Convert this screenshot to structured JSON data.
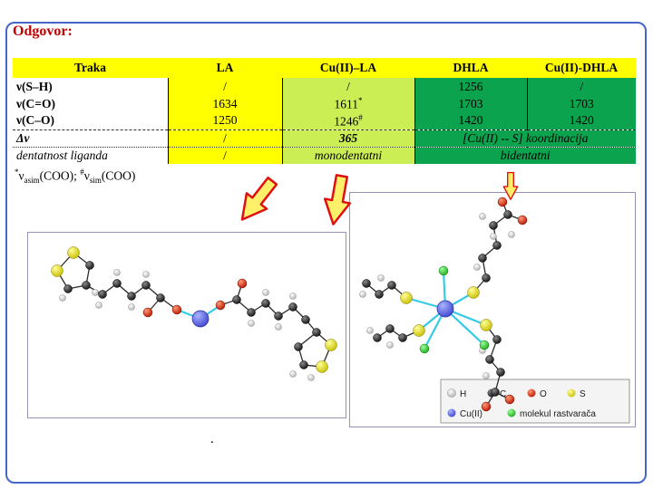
{
  "title": "Odgovor:",
  "table": {
    "headers": [
      "Traka",
      "LA",
      "Cu(II)–LA",
      "DHLA",
      "Cu(II)-DHLA"
    ],
    "rows": [
      {
        "label": "ν(S–H)",
        "la": "/",
        "cu_la": "/",
        "dhla": "1256",
        "cu_dhla": "/"
      },
      {
        "label": "ν(C=O)",
        "la": "1634",
        "cu_la": "1611",
        "cu_la_mark": "*",
        "dhla": "1703",
        "cu_dhla": "1703"
      },
      {
        "label": "ν(C–O)",
        "la": "1250",
        "cu_la": "1246",
        "cu_la_mark": "#",
        "dhla": "1420",
        "cu_dhla": "1420"
      },
      {
        "label": "Δν",
        "la": "/",
        "cu_la": "365",
        "green": "[Cu(II) -- S] koordinacija"
      },
      {
        "label": "dentatnost liganda",
        "la": "/",
        "cu_la": "monodentatni",
        "green": "bidentatni"
      }
    ],
    "footnote": {
      "mark1": "*",
      "symbol1": "ν",
      "sub1": "asim",
      "rest1": "(COO); ",
      "mark2": "#",
      "symbol2": "ν",
      "sub2": "sim",
      "rest2": "(COO)"
    }
  },
  "legend": {
    "row1": [
      {
        "label": "H",
        "color": "#E9E9E9"
      },
      {
        "label": "C",
        "color": "#1C1C1C"
      },
      {
        "label": "O",
        "color": "#D03010"
      },
      {
        "label": "S",
        "color": "#E6D800"
      }
    ],
    "row2": [
      {
        "label": "Cu(II)",
        "color": "#5B63E8"
      },
      {
        "label": "molekul rastvarača",
        "color": "#3ECC3E"
      }
    ]
  },
  "colors": {
    "title_red": "#C00000",
    "header_yellow": "#FFFF00",
    "cu_la_lime": "#CCEE55",
    "dhla_green": "#0CA34E",
    "frame_blue": "#4565C8",
    "arrow_outline_red": "#E01010",
    "arrow_fill_yellow": "#FFF06A",
    "coordination_bond_cyan": "#35CBE8"
  },
  "misc": {
    "dot": "."
  }
}
